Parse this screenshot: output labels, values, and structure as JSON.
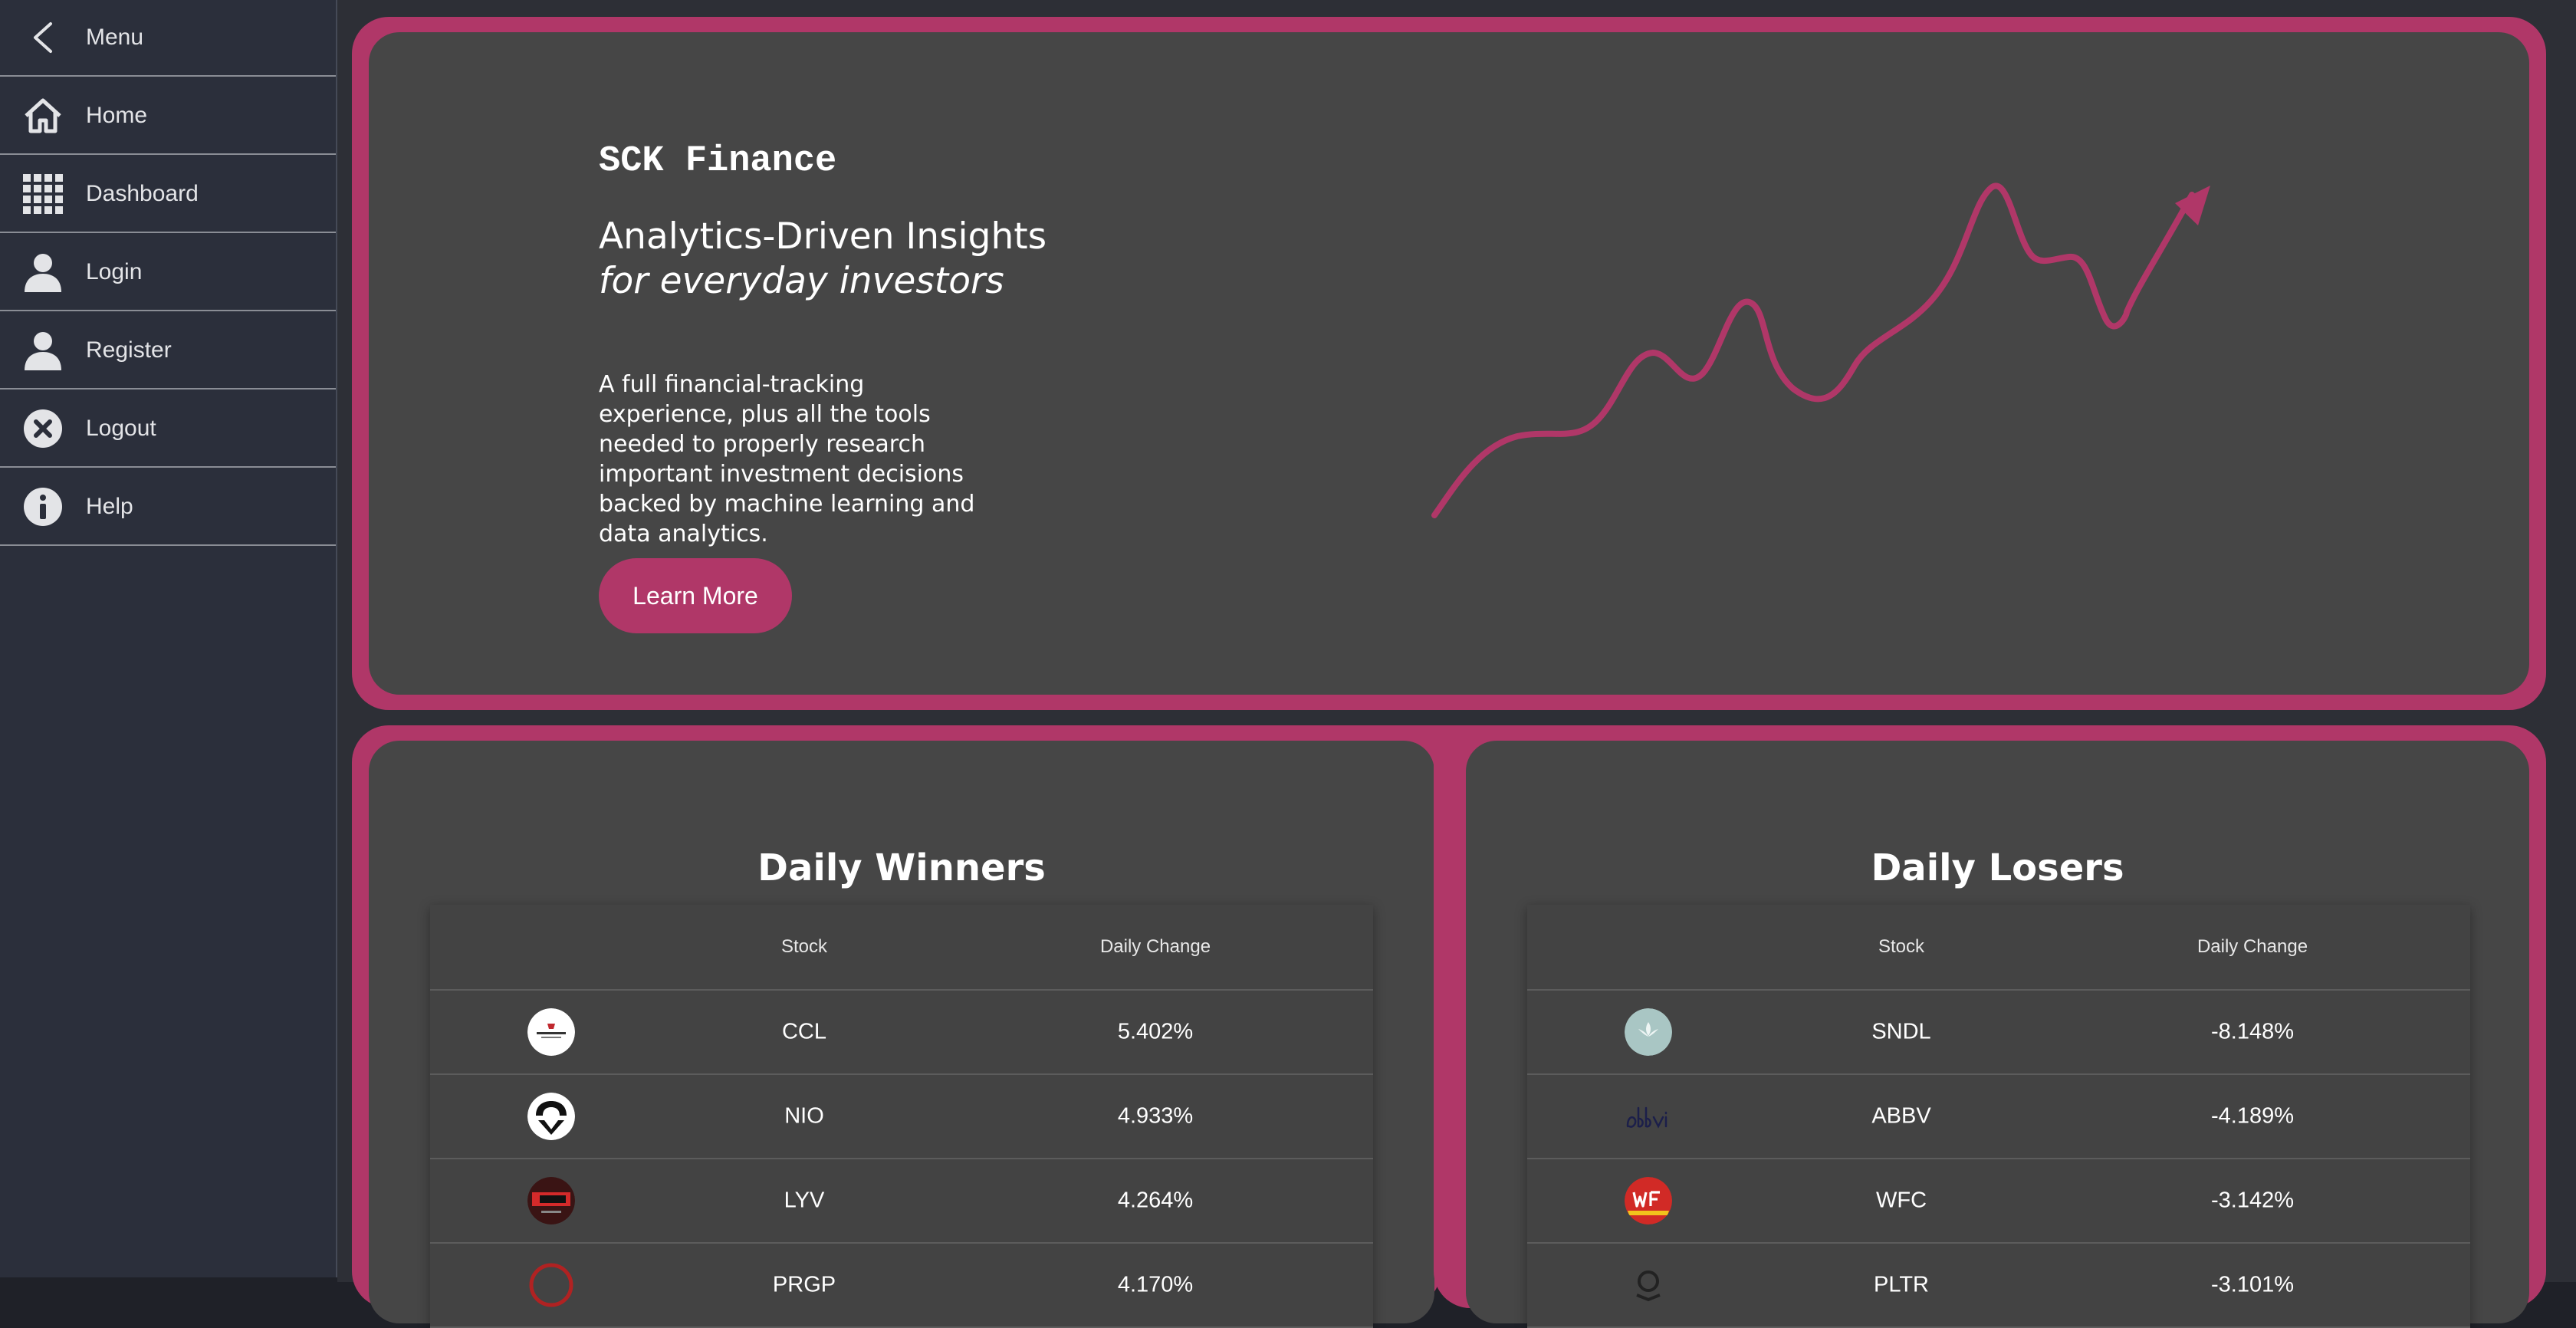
{
  "sidebar": {
    "items": [
      {
        "label": "Menu",
        "icon": "back-chevron-icon"
      },
      {
        "label": "Home",
        "icon": "home-icon"
      },
      {
        "label": "Dashboard",
        "icon": "grid-icon"
      },
      {
        "label": "Login",
        "icon": "user-icon"
      },
      {
        "label": "Register",
        "icon": "user-icon"
      },
      {
        "label": "Logout",
        "icon": "close-circle-icon"
      },
      {
        "label": "Help",
        "icon": "info-icon"
      }
    ]
  },
  "hero": {
    "brand": "SCK Finance",
    "headline": "Analytics-Driven Insights",
    "headline_italic": "for everyday investors",
    "description": "A full financial-tracking experience, plus all the tools needed to properly research important investment decisions backed by machine learning and data analytics.",
    "cta_label": "Learn More"
  },
  "colors": {
    "accent": "#b03768",
    "card": "#464646",
    "sidebar": "#2b2f3b",
    "text": "#ffffff"
  },
  "winners": {
    "title": "Daily Winners",
    "headers": {
      "stock": "Stock",
      "change": "Daily Change"
    },
    "rows": [
      {
        "symbol": "CCL",
        "change": "5.402%",
        "logo": "carnival-logo"
      },
      {
        "symbol": "NIO",
        "change": "4.933%",
        "logo": "nio-logo"
      },
      {
        "symbol": "LYV",
        "change": "4.264%",
        "logo": "live-nation-logo"
      },
      {
        "symbol": "PRGP",
        "change": "4.170%",
        "logo": "red-logo"
      }
    ]
  },
  "losers": {
    "title": "Daily Losers",
    "headers": {
      "stock": "Stock",
      "change": "Daily Change"
    },
    "rows": [
      {
        "symbol": "SNDL",
        "change": "-8.148%",
        "logo": "sundial-logo"
      },
      {
        "symbol": "ABBV",
        "change": "-4.189%",
        "logo": "abbvie-logo"
      },
      {
        "symbol": "WFC",
        "change": "-3.142%",
        "logo": "wells-fargo-logo"
      },
      {
        "symbol": "PLTR",
        "change": "-3.101%",
        "logo": "palantir-logo"
      }
    ]
  }
}
